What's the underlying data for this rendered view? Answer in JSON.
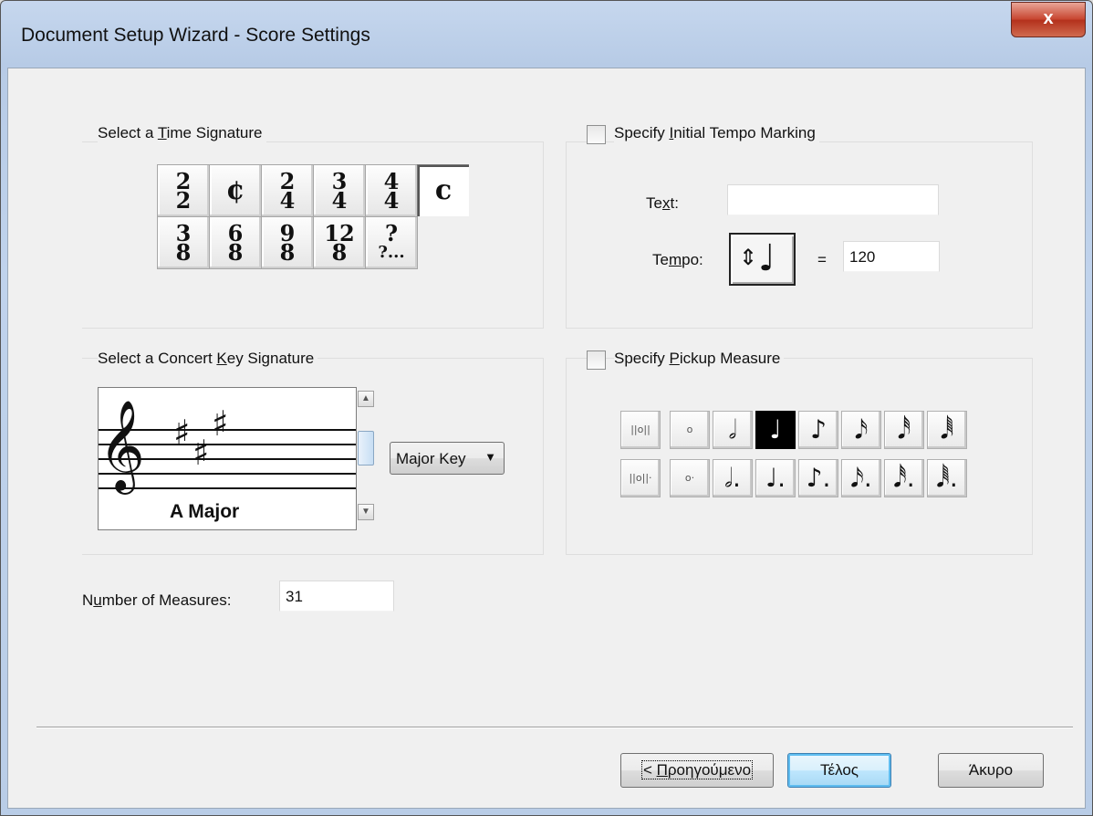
{
  "window": {
    "title": "Document Setup Wizard - Score Settings",
    "close_glyph": "x"
  },
  "time_signature": {
    "label_pre": "Select a ",
    "label_key": "T",
    "label_post": "ime Signature",
    "row1": [
      {
        "top": "2",
        "bottom": "2"
      },
      {
        "single": "¢"
      },
      {
        "top": "2",
        "bottom": "4"
      },
      {
        "top": "3",
        "bottom": "4"
      },
      {
        "top": "4",
        "bottom": "4"
      },
      {
        "single": "c"
      }
    ],
    "row2": [
      {
        "top": "3",
        "bottom": "8"
      },
      {
        "top": "6",
        "bottom": "8"
      },
      {
        "top": "9",
        "bottom": "8"
      },
      {
        "top": "12",
        "bottom": "8"
      },
      {
        "top": "?",
        "bottom": "?..."
      }
    ],
    "selected": "c"
  },
  "key_signature": {
    "label_pre": "Select a Concert ",
    "label_key": "K",
    "label_post": "ey Signature",
    "clef": "𝄞",
    "sharp": "♯",
    "key_name": "A Major",
    "mode_select": "Major Key",
    "scroll_up": "▲",
    "scroll_down": "▼",
    "combo_arrow": "▼"
  },
  "measures": {
    "label_pre": "N",
    "label_key": "u",
    "label_post": "mber of Measures:",
    "value": "31"
  },
  "tempo": {
    "checkbox_pre": "Specify ",
    "checkbox_key": "I",
    "checkbox_post": "nitial Tempo Marking",
    "checked": false,
    "text_label_pre": "Te",
    "text_label_key": "x",
    "text_label_post": "t:",
    "text_value": "",
    "tempo_label_pre": "Te",
    "tempo_label_key": "m",
    "tempo_label_post": "po:",
    "updown": "⇕",
    "note": "♩",
    "equals": "=",
    "value": "120"
  },
  "pickup": {
    "checkbox_pre": "Specify ",
    "checkbox_key": "P",
    "checkbox_post": "ickup Measure",
    "checked": false,
    "row1": [
      "||o||",
      "o",
      "𝅗𝅥",
      "♩",
      "♪",
      "𝅘𝅥𝅯",
      "𝅘𝅥𝅰",
      "𝅘𝅥𝅱"
    ],
    "row2": [
      "||o||·",
      "o·",
      "𝅗𝅥.",
      "♩.",
      "♪.",
      "𝅘𝅥𝅯.",
      "𝅘𝅥𝅰.",
      "𝅘𝅥𝅱."
    ],
    "selected": "♩"
  },
  "buttons": {
    "back_pre": "< ",
    "back_key": "Π",
    "back_post": "ροηγούμενο",
    "finish": "Τέλος",
    "cancel": "Άκυρο"
  }
}
